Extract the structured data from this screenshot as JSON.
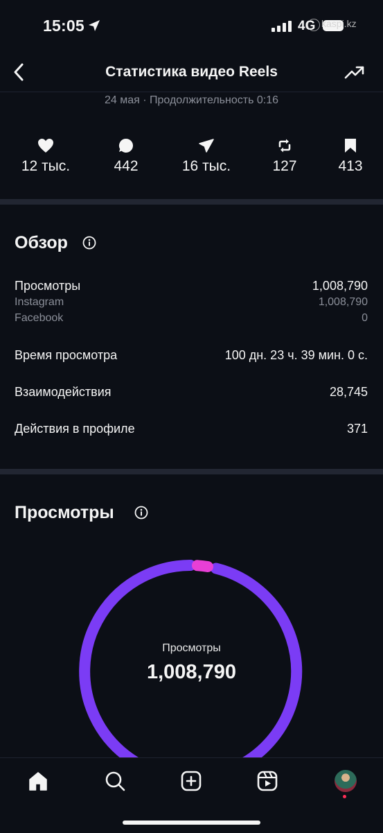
{
  "status_bar": {
    "time": "15:05",
    "network": "4G",
    "watermark": "kaspi.kz"
  },
  "header": {
    "title": "Статистика видео Reels",
    "subtitle": "24 мая · Продолжительность 0:16"
  },
  "stats": [
    {
      "icon": "heart-icon",
      "value": "12 тыс."
    },
    {
      "icon": "comment-icon",
      "value": "442"
    },
    {
      "icon": "share-icon",
      "value": "16 тыс."
    },
    {
      "icon": "repost-icon",
      "value": "127"
    },
    {
      "icon": "bookmark-icon",
      "value": "413"
    }
  ],
  "overview": {
    "title": "Обзор",
    "views_label": "Просмотры",
    "views_value": "1,008,790",
    "instagram_label": "Instagram",
    "instagram_value": "1,008,790",
    "facebook_label": "Facebook",
    "facebook_value": "0",
    "watch_time_label": "Время просмотра",
    "watch_time_value": "100 дн. 23 ч. 39 мин. 0 с.",
    "interactions_label": "Взаимодействия",
    "interactions_value": "28,745",
    "profile_actions_label": "Действия в профиле",
    "profile_actions_value": "371"
  },
  "views_section": {
    "title": "Просмотры",
    "donut_label": "Просмотры",
    "donut_value": "1,008,790",
    "colors": {
      "main": "#7b3cf5",
      "accent": "#e83fd6"
    }
  },
  "nav": [
    "home-icon",
    "search-icon",
    "create-icon",
    "reels-icon",
    "profile-avatar"
  ]
}
